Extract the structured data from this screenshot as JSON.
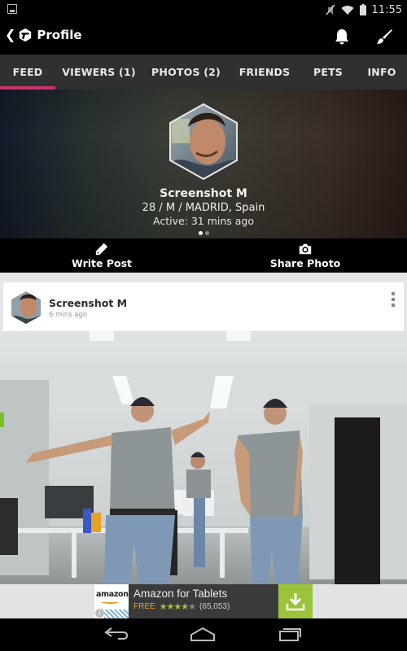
{
  "status_bar": {
    "time": "11:55",
    "icons": [
      "image-notification-icon",
      "mute-icon",
      "wifi-icon",
      "battery-icon"
    ]
  },
  "app_bar": {
    "title": "Profile",
    "icons": [
      "back-chevron-icon",
      "app-logo-icon",
      "bell-icon",
      "brush-icon"
    ]
  },
  "tabs": [
    {
      "label": "FEED",
      "active": true
    },
    {
      "label": "VIEWERS (1)",
      "active": false
    },
    {
      "label": "PHOTOS (2)",
      "active": false
    },
    {
      "label": "FRIENDS",
      "active": false
    },
    {
      "label": "PETS",
      "active": false
    },
    {
      "label": "INFO",
      "active": false
    }
  ],
  "profile": {
    "name": "Screenshot M",
    "meta": "28 / M / MADRID, Spain",
    "active": "Active: 31 mins ago",
    "carousel_page": 1,
    "carousel_total": 2
  },
  "actions": {
    "write_post": "Write Post",
    "share_photo": "Share Photo"
  },
  "post": {
    "author": "Screenshot M",
    "time": "6 mins ago",
    "menu_icon": "overflow-menu-icon"
  },
  "ad": {
    "brand": "amazon",
    "title": "Amazon for Tablets",
    "price": "FREE",
    "rating": 4,
    "rating_max": 5,
    "reviews": "(65,053)",
    "info_glyph": "i"
  },
  "colors": {
    "accent": "#c8356a",
    "tab_bar": "#2f3032",
    "ad_download": "#9bc33b",
    "ad_free": "#f0a030"
  }
}
